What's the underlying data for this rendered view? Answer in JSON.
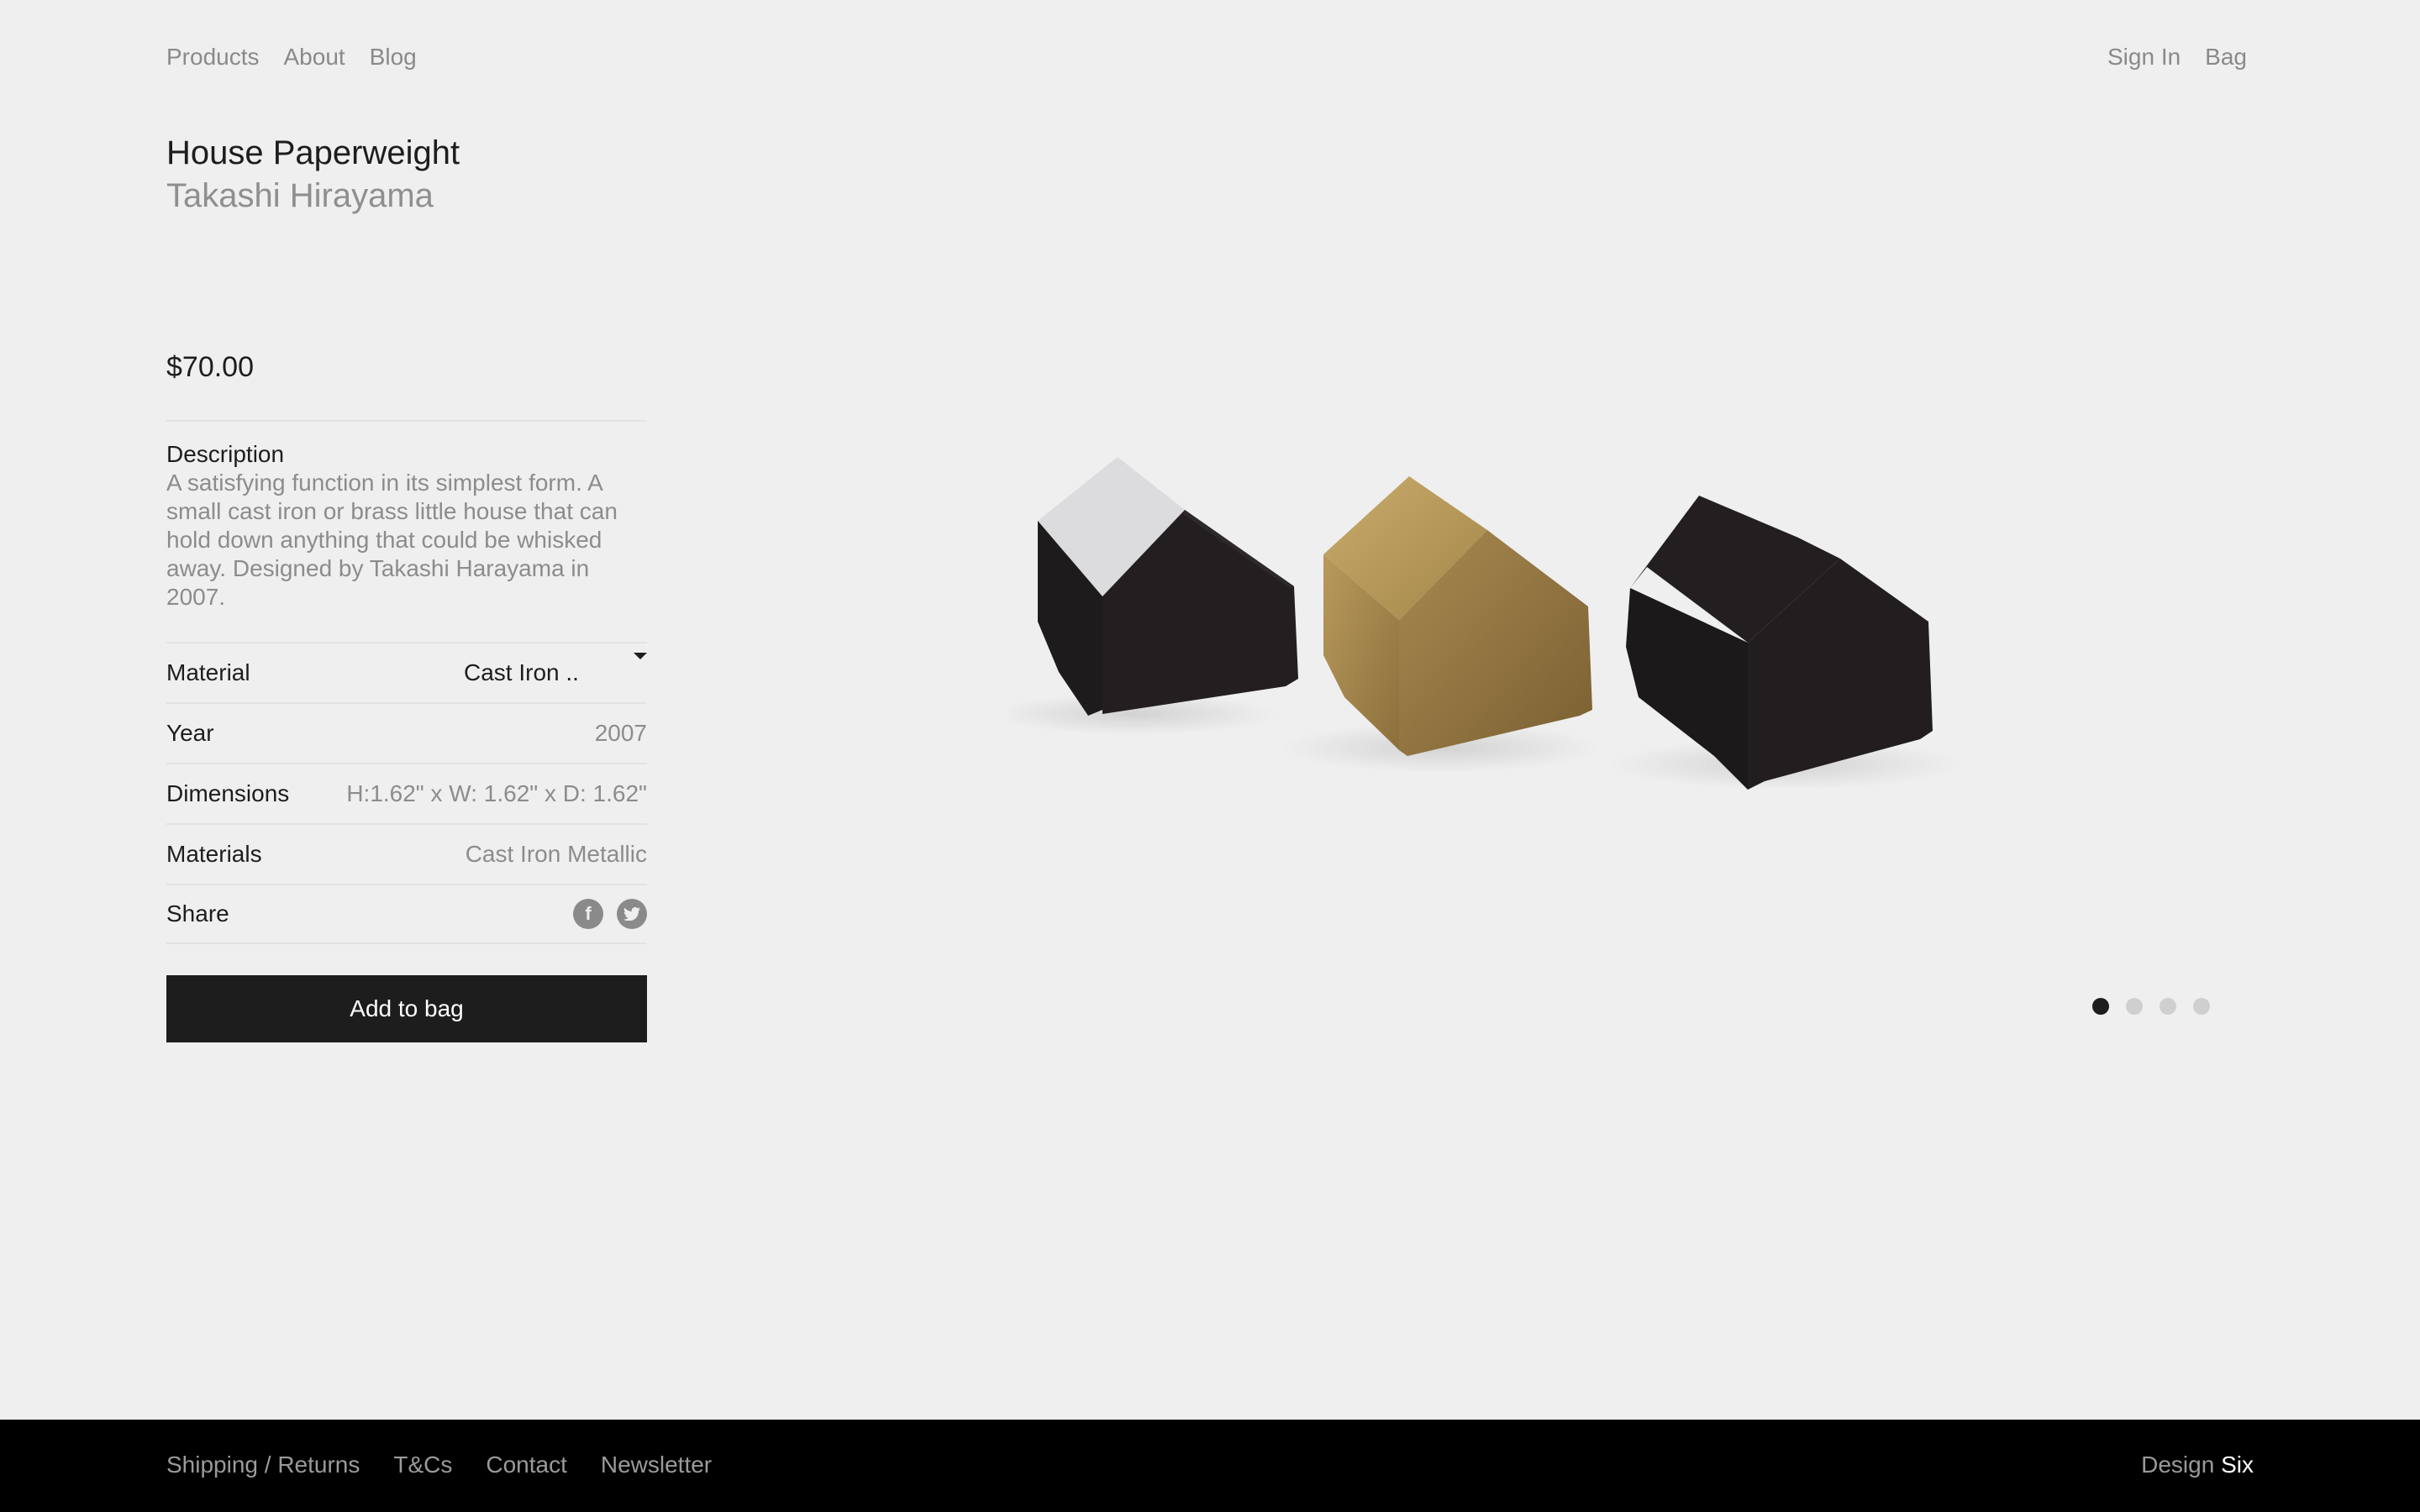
{
  "nav": {
    "left": [
      "Products",
      "About",
      "Blog"
    ],
    "right": [
      "Sign In",
      "Bag"
    ]
  },
  "product": {
    "title": "House Paperweight",
    "designer": "Takashi Hirayama",
    "price": "$70.00",
    "description_label": "Description",
    "description": "A satisfying function in its simplest form. A small cast iron or brass little house that can hold down anything that could be whisked away. Designed by Takashi Harayama in 2007.",
    "material": {
      "label": "Material",
      "selected": "Cast Iron .."
    },
    "year": {
      "label": "Year",
      "value": "2007"
    },
    "dimensions": {
      "label": "Dimensions",
      "value": "H:1.62\" x W: 1.62\" x D: 1.62\""
    },
    "materials": {
      "label": "Materials",
      "value": "Cast Iron Metallic"
    },
    "share": {
      "label": "Share",
      "icons": [
        "facebook-icon",
        "twitter-icon"
      ]
    },
    "add_to_bag": "Add to bag"
  },
  "carousel": {
    "count": 4,
    "active_index": 0
  },
  "footer": {
    "links": [
      "Shipping / Returns",
      "T&Cs",
      "Contact",
      "Newsletter"
    ],
    "brand_light": "Design",
    "brand_strong": "Six"
  },
  "colors": {
    "background": "#efefef",
    "text": "#1d1d1d",
    "muted": "#8c8c8c",
    "button": "#1d1d1d",
    "footer": "#000000"
  }
}
